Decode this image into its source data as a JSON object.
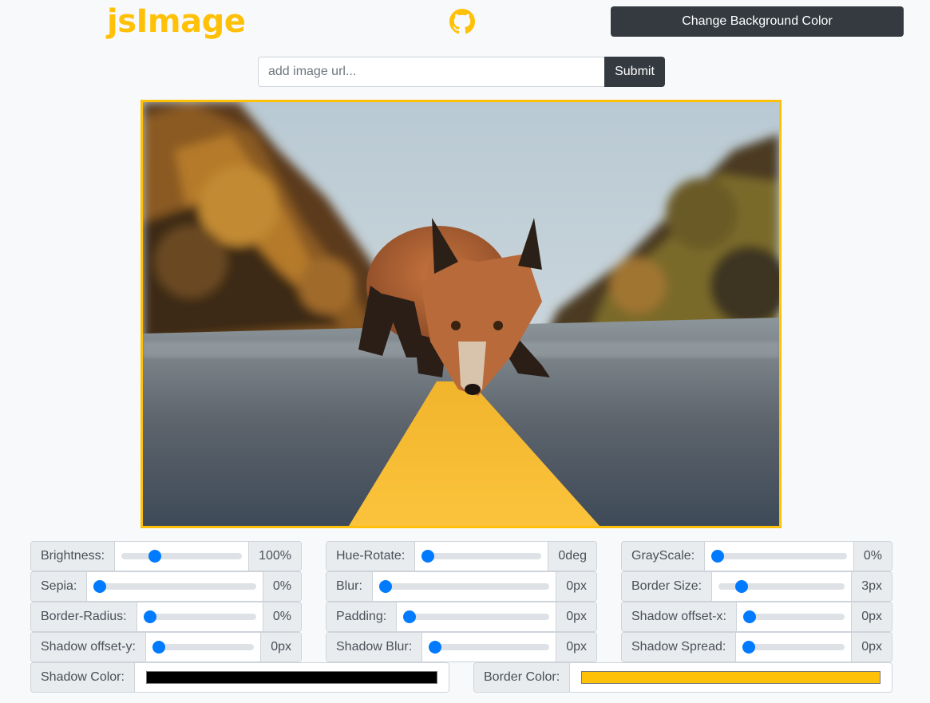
{
  "header": {
    "logo": "jsImage",
    "github_icon": "github-icon",
    "bg_button": "Change Background Color"
  },
  "url_form": {
    "placeholder": "add image url...",
    "value": "",
    "submit": "Submit"
  },
  "preview": {
    "border_color": "#ffc107",
    "subject": "fox-on-road-image"
  },
  "controls": [
    {
      "label": "Brightness:",
      "value": "100%",
      "level": 0.25
    },
    {
      "label": "Hue-Rotate:",
      "value": "0deg",
      "level": 0
    },
    {
      "label": "GrayScale:",
      "value": "0%",
      "level": 0
    },
    {
      "label": "Sepia:",
      "value": "0%",
      "level": 0
    },
    {
      "label": "Blur:",
      "value": "0px",
      "level": 0
    },
    {
      "label": "Border Size:",
      "value": "3px",
      "level": 0.15
    },
    {
      "label": "Border-Radius:",
      "value": "0%",
      "level": 0
    },
    {
      "label": "Padding:",
      "value": "0px",
      "level": 0
    },
    {
      "label": "Shadow offset-x:",
      "value": "0px",
      "level": 0
    },
    {
      "label": "Shadow offset-y:",
      "value": "0px",
      "level": 0
    },
    {
      "label": "Shadow Blur:",
      "value": "0px",
      "level": 0
    },
    {
      "label": "Shadow Spread:",
      "value": "0px",
      "level": 0
    }
  ],
  "colors": {
    "shadow_label": "Shadow Color:",
    "shadow_color": "#000000",
    "border_label": "Border Color:",
    "border_color": "#ffc107"
  },
  "theme": {
    "accent": "#ffc107",
    "dark": "#343a40",
    "slider_thumb": "#007bff"
  }
}
